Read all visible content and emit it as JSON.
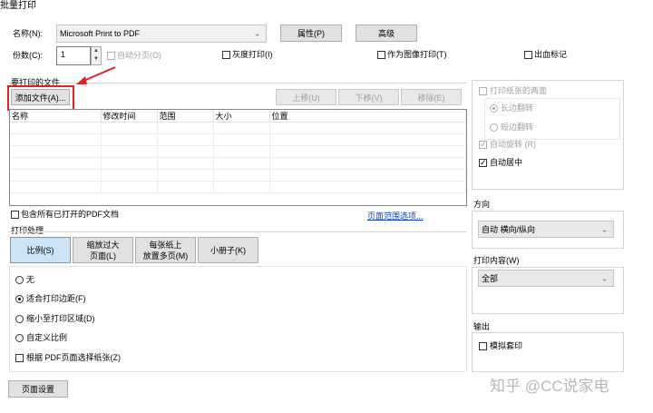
{
  "window": {
    "title": "批量打印"
  },
  "printer": {
    "name_label": "名称(N):",
    "name_value": "Microsoft Print to PDF",
    "properties_btn": "属性(P)",
    "advanced_btn": "高级",
    "copies_label": "份数(C):",
    "copies_value": "1",
    "collate_label": "自动分页(O)",
    "grayscale_label": "灰度打印(I)",
    "as_image_label": "作为图像打印(T)",
    "bleed_label": "出血标记"
  },
  "files": {
    "section_label": "要打印的文件",
    "add_btn": "添加文件(A)...",
    "move_up_btn": "上移(U)",
    "move_down_btn": "下移(V)",
    "remove_btn": "移除(E)",
    "columns": [
      "名称",
      "修改时间",
      "范围",
      "大小",
      "位置"
    ],
    "include_open_label": "包含所有已打开的PDF文档",
    "page_range_link": "页面范围选项..."
  },
  "handling": {
    "section_label": "打印处理",
    "tabs": [
      "比例(S)",
      "缩放过大\n页面(L)",
      "每张纸上\n放置多页(M)",
      "小册子(K)"
    ],
    "options": [
      "无",
      "适合打印边距(F)",
      "缩小至打印区域(D)",
      "自定义比例"
    ],
    "paper_by_pdf_label": "根据 PDF页面选择纸张(Z)"
  },
  "duplex": {
    "both_sides_label": "打印纸张的两面",
    "long_edge_label": "长边翻转",
    "short_edge_label": "短边翻转",
    "auto_rotate_label": "自动旋转 (R)",
    "auto_center_label": "自动居中"
  },
  "orientation": {
    "label": "方向",
    "value": "自动 横向/纵向"
  },
  "content": {
    "label": "打印内容(W)",
    "value": "全部"
  },
  "output": {
    "label": "输出",
    "simulate_overprint_label": "模拟套印"
  },
  "footer": {
    "page_setup_btn": "页面设置",
    "watermark": "知乎 @CC说家电"
  },
  "colors": {
    "annotation_red": "#e02020",
    "active_tab": "#cce4f7"
  }
}
